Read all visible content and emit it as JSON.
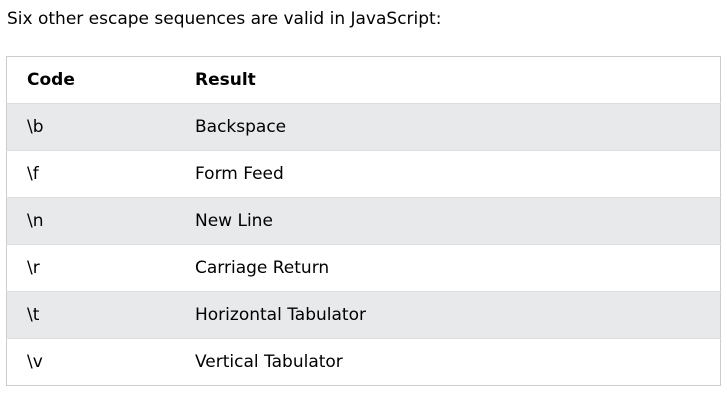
{
  "intro_text": "Six other escape sequences are valid in JavaScript:",
  "table": {
    "headers": {
      "code": "Code",
      "result": "Result"
    },
    "rows": [
      {
        "code": "\\b",
        "result": "Backspace"
      },
      {
        "code": "\\f",
        "result": "Form Feed"
      },
      {
        "code": "\\n",
        "result": "New Line"
      },
      {
        "code": "\\r",
        "result": "Carriage Return"
      },
      {
        "code": "\\t",
        "result": "Horizontal Tabulator"
      },
      {
        "code": "\\v",
        "result": "Vertical Tabulator"
      }
    ]
  },
  "colors": {
    "stripe": "#e7e9eb",
    "border": "#cccccc"
  }
}
